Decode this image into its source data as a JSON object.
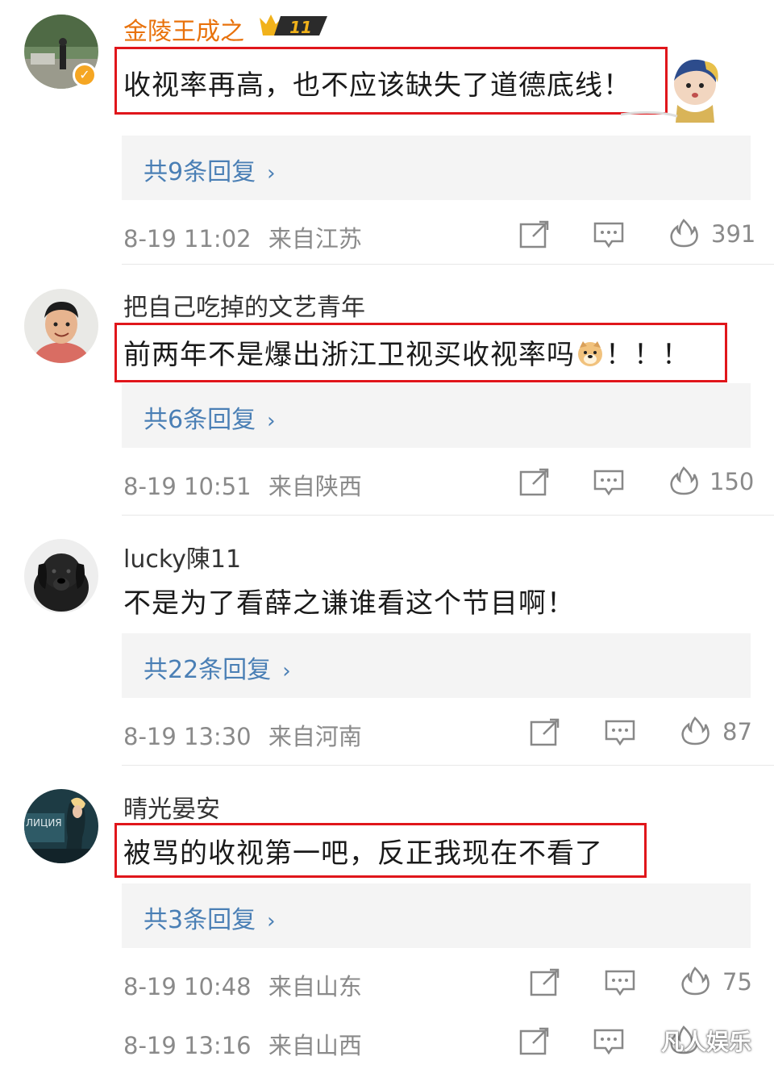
{
  "comments": [
    {
      "username": "金陵王成之",
      "level": "11",
      "content": "收视率再高，也不应该缺失了道德底线！",
      "replies": "共9条回复",
      "time": "8-19 11:02",
      "location": "来自江苏",
      "likes": "391"
    },
    {
      "username": "把自己吃掉的文艺青年",
      "content_before_emoji": "前两年不是爆出浙江卫视买收视率吗",
      "content_after_emoji": "！！！",
      "replies": "共6条回复",
      "time": "8-19 10:51",
      "location": "来自陕西",
      "likes": "150"
    },
    {
      "username": "lucky陳11",
      "content": "不是为了看薛之谦谁看这个节目啊！",
      "replies": "共22条回复",
      "time": "8-19 13:30",
      "location": "来自河南",
      "likes": "87"
    },
    {
      "username": "晴光晏安",
      "avatar_text": "ЛИЦИЯ",
      "content": "被骂的收视第一吧，反正我现在不看了",
      "replies": "共3条回复",
      "time": "8-19 10:48",
      "location": "来自山东",
      "likes": "75"
    }
  ],
  "last_meta": {
    "time": "8-19 13:16",
    "location": "来自山西"
  },
  "watermark": "凡人娱乐",
  "icons": {
    "share": "share-icon",
    "comment": "comment-icon",
    "like": "flame-like-icon",
    "chevron": "chevron-right-icon",
    "verified": "verified-badge-icon"
  },
  "colors": {
    "vip_name": "#e8720c",
    "reply_link": "#4a7fb5",
    "highlight_box": "#e0161b",
    "meta_text": "#8a8a8a"
  }
}
